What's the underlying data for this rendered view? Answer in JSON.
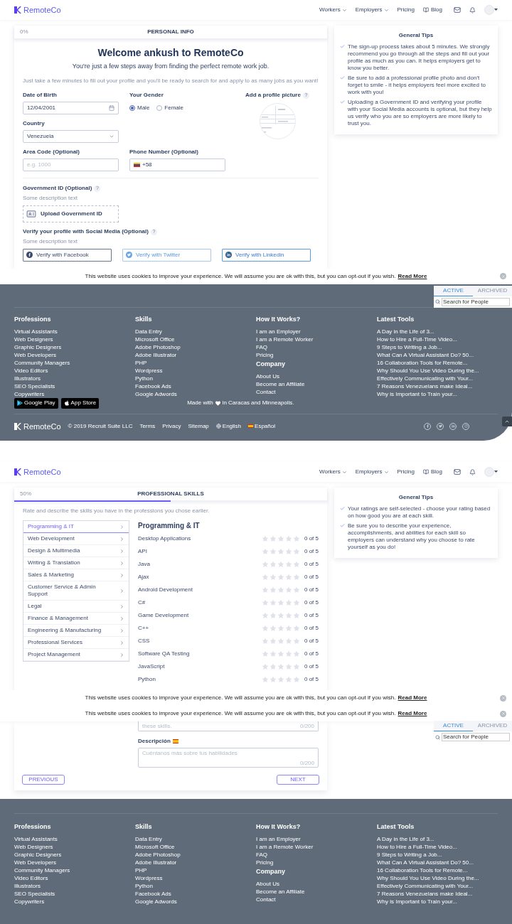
{
  "pages": [
    {
      "kind": "personal_info",
      "header": {
        "logo": "RemoteCo",
        "nav": [
          {
            "kind": "dropdown",
            "label": "Workers"
          },
          {
            "kind": "dropdown",
            "label": "Employers"
          },
          {
            "kind": "link",
            "label": "Pricing"
          },
          {
            "kind": "blog",
            "label": "Blog"
          }
        ]
      },
      "progress": {
        "percent": "0%",
        "level": 0,
        "step": "PERSONAL INFO"
      },
      "form": {
        "title": "Welcome ankush to RemoteCo",
        "subtitle": "You're just a few steps away from finding the perfect remote work job.",
        "intro": "Just take a few minutes to fill out your profile and you'll be ready to search for and apply to as many jobs as you want!",
        "date_of_birth": {
          "label": "Date of Birth",
          "value": "12/04/2001"
        },
        "gender": {
          "label": "Your Gender",
          "options": [
            {
              "label": "Male",
              "selected": true
            },
            {
              "label": "Female",
              "selected": false
            }
          ]
        },
        "profile_picture": {
          "label": "Add a profile picture",
          "help": "?"
        },
        "country": {
          "label": "Country",
          "value": "Venezuela"
        },
        "area_code": {
          "label": "Area Code (Optional)",
          "placeholder": "e.g. 1000"
        },
        "phone": {
          "label": "Phone Number (Optional)",
          "value": "+58"
        },
        "government_id": {
          "label": "Government ID (Optional)",
          "help": "?",
          "description": "Some description text",
          "button": "Upload Government ID"
        },
        "social": {
          "label": "Verify your profile with Social Media (Optional)",
          "help": "?",
          "description": "Some description text",
          "buttons": [
            {
              "kind": "facebook",
              "label": "Verify with Facebook"
            },
            {
              "kind": "twitter",
              "label": "Verify with Twitter"
            },
            {
              "kind": "linkedin",
              "label": "Verify with Linkedin"
            }
          ]
        }
      },
      "tips": {
        "title": "General Tips",
        "items": [
          "The sign-up process takes about 5 minutes. We strongly recommend you go through all the steps and fill out your profile as much as you can. It helps employers get to know you better.",
          "Be sure to add a professional profile photo and don't forget to smile - it helps employers feel more excited to work with you!",
          "Uploading a Government ID and verifying your profile with your Social Media accounts is optional, but they help us verify who you are so employers are more likely to trust you."
        ]
      },
      "cookie_bars": [
        {
          "text": "This website uses cookies to improve your experience. We will assume you are ok with this, but you can opt-out if you wish.",
          "link": "Read More"
        }
      ],
      "side_panel": {
        "tabs": [
          {
            "label": "ACTIVE",
            "selected": true
          },
          {
            "label": "ARCHIVED",
            "selected": false
          }
        ],
        "search": {
          "placeholder": "Search for People"
        }
      },
      "footer": {
        "columns": [
          {
            "sections": [
              {
                "title": "Professions",
                "links": [
                  "Virtual Assistants",
                  "Web Designers",
                  "Graphic Designers",
                  "Web Developers",
                  "Community Managers",
                  "Video Editors",
                  "Illustrators",
                  "SEO Specialists",
                  "Copywriters"
                ]
              }
            ]
          },
          {
            "sections": [
              {
                "title": "Skills",
                "links": [
                  "Data Entry",
                  "Microsoft Office",
                  "Adobe Photoshop",
                  "Adobe Illustrator",
                  "PHP",
                  "Wordpress",
                  "Python",
                  "Facebook Ads",
                  "Google Adwords"
                ]
              }
            ]
          },
          {
            "sections": [
              {
                "title": "How It Works?",
                "links": [
                  "I am an Employer",
                  "I am a Remote Worker",
                  "FAQ",
                  "Pricing"
                ]
              },
              {
                "title": "Company",
                "links": [
                  "About Us",
                  "Become an Affiliate",
                  "Contact"
                ]
              }
            ]
          },
          {
            "sections": [
              {
                "title": "Latest Tools",
                "links": [
                  "A Day in the Life of 3...",
                  "How to Hire a Full-Time Video...",
                  "9 Steps to Writing a Job...",
                  "What Can A Virtual Assistant Do? 50...",
                  "16 Collaboration Tools for Remote...",
                  "Why Should You Use Video During the...",
                  "Effectively Communicating with Your...",
                  "7 Reasons Venezuelans make Ideal...",
                  "Why is Important to Train your..."
                ]
              }
            ]
          }
        ],
        "apps": [
          {
            "kind": "google",
            "label": "Google Play"
          },
          {
            "kind": "apple",
            "label": "App Store"
          }
        ],
        "made_with": {
          "before": "Made with",
          "after": "in Caracas and Minneapolis."
        },
        "bottom": {
          "logo": "RemoteCo",
          "copyright": "© 2019 Recruit Suite LLC",
          "links": [
            {
              "kind": "plain",
              "label": "Terms"
            },
            {
              "kind": "plain",
              "label": "Privacy"
            },
            {
              "kind": "plain",
              "label": "Sitemap"
            },
            {
              "kind": "globe",
              "label": "English"
            },
            {
              "kind": "flag",
              "label": "Español"
            }
          ],
          "social": [
            {
              "kind": "facebook"
            },
            {
              "kind": "twitter"
            },
            {
              "kind": "linkedin"
            },
            {
              "kind": "instagram"
            }
          ]
        }
      }
    },
    {
      "kind": "professional_skills",
      "header": {
        "logo": "RemoteCo",
        "nav": [
          {
            "kind": "dropdown",
            "label": "Workers"
          },
          {
            "kind": "dropdown",
            "label": "Employers"
          },
          {
            "kind": "link",
            "label": "Pricing"
          },
          {
            "kind": "blog",
            "label": "Blog"
          }
        ]
      },
      "progress": {
        "percent": "50%",
        "level": 0.5,
        "step": "PROFESSIONAL SKILLS"
      },
      "form": {
        "intro": "Rate and describe the skills you have in the professions you chose earlier.",
        "categories": [
          {
            "label": "Programming & IT",
            "selected": true
          },
          {
            "label": "Web Development",
            "selected": false
          },
          {
            "label": "Design & Multimedia",
            "selected": false
          },
          {
            "label": "Writing & Translation",
            "selected": false
          },
          {
            "label": "Sales & Marketing",
            "selected": false
          },
          {
            "label": "Customer Service & Admin Support",
            "selected": false
          },
          {
            "label": "Legal",
            "selected": false
          },
          {
            "label": "Finance & Management",
            "selected": false
          },
          {
            "label": "Engineering & Manufacturing",
            "selected": false
          },
          {
            "label": "Professional Services",
            "selected": false
          },
          {
            "label": "Project Management",
            "selected": false
          }
        ],
        "skills_title": "Programming & IT",
        "skills": [
          {
            "name": "Desktop Applications",
            "stars": 0,
            "rating": "0 of 5"
          },
          {
            "name": "API",
            "stars": 0,
            "rating": "0 of 5"
          },
          {
            "name": "Java",
            "stars": 0,
            "rating": "0 of 5"
          },
          {
            "name": "Ajax",
            "stars": 0,
            "rating": "0 of 5"
          },
          {
            "name": "Android Development",
            "stars": 0,
            "rating": "0 of 5"
          },
          {
            "name": "C#",
            "stars": 0,
            "rating": "0 of 5"
          },
          {
            "name": "Game Development",
            "stars": 0,
            "rating": "0 of 5"
          },
          {
            "name": "C++",
            "stars": 0,
            "rating": "0 of 5"
          },
          {
            "name": "CSS",
            "stars": 0,
            "rating": "0 of 5"
          },
          {
            "name": "Software QA Testing",
            "stars": 0,
            "rating": "0 of 5"
          },
          {
            "name": "JavaScript",
            "stars": 0,
            "rating": "0 of 5"
          },
          {
            "name": "Python",
            "stars": 0,
            "rating": "0 of 5"
          }
        ],
        "description_en": {
          "placeholder": "these skills.",
          "counter": "0/200"
        },
        "description_es": {
          "label": "Descripción",
          "placeholder": "Cuéntanos más sobre tus habilidades",
          "counter": "0/200"
        },
        "previous": "PREVIOUS",
        "next": "NEXT"
      },
      "tips": {
        "title": "General Tips",
        "items": [
          "Your ratings are self-selected - choose your rating based on how good you are at each skill.",
          "Be sure you to describe your experience, accomplishments, and abilities for each skill so employers can understand why you choose to rate yourself as you do!"
        ]
      },
      "cookie_bars": [
        {
          "text": "This website uses cookies to improve your experience. We will assume you are ok with this, but you can opt-out if you wish.",
          "link": "Read More"
        },
        {
          "text": "This website uses cookies to improve your experience. We will assume you are ok with this, but you can opt-out if you wish.",
          "link": "Read More"
        }
      ],
      "side_panel": {
        "tabs": [
          {
            "label": "ACTIVE",
            "selected": true
          },
          {
            "label": "ARCHIVED",
            "selected": false
          }
        ],
        "search": {
          "placeholder": "Search for People"
        }
      },
      "footer": {
        "columns": [
          {
            "sections": [
              {
                "title": "Professions",
                "links": [
                  "Virtual Assistants",
                  "Web Designers",
                  "Graphic Designers",
                  "Web Developers",
                  "Community Managers",
                  "Video Editors",
                  "Illustrators",
                  "SEO Specialists",
                  "Copywriters"
                ]
              }
            ]
          },
          {
            "sections": [
              {
                "title": "Skills",
                "links": [
                  "Data Entry",
                  "Microsoft Office",
                  "Adobe Photoshop",
                  "Adobe Illustrator",
                  "PHP",
                  "Wordpress",
                  "Python",
                  "Facebook Ads",
                  "Google Adwords"
                ]
              }
            ]
          },
          {
            "sections": [
              {
                "title": "How It Works?",
                "links": [
                  "I am an Employer",
                  "I am a Remote Worker",
                  "FAQ",
                  "Pricing"
                ]
              },
              {
                "title": "Company",
                "links": [
                  "About Us",
                  "Become an Affiliate",
                  "Contact"
                ]
              }
            ]
          },
          {
            "sections": [
              {
                "title": "Latest Tools",
                "links": [
                  "A Day in the Life of 3...",
                  "How to Hire a Full-Time Video...",
                  "9 Steps to Writing a Job...",
                  "What Can A Virtual Assistant Do? 50...",
                  "16 Collaboration Tools for Remote...",
                  "Why Should You Use Video During the...",
                  "Effectively Communicating with Your...",
                  "7 Reasons Venezuelans make Ideal...",
                  "Why is Important to Train your..."
                ]
              }
            ]
          }
        ]
      }
    }
  ]
}
